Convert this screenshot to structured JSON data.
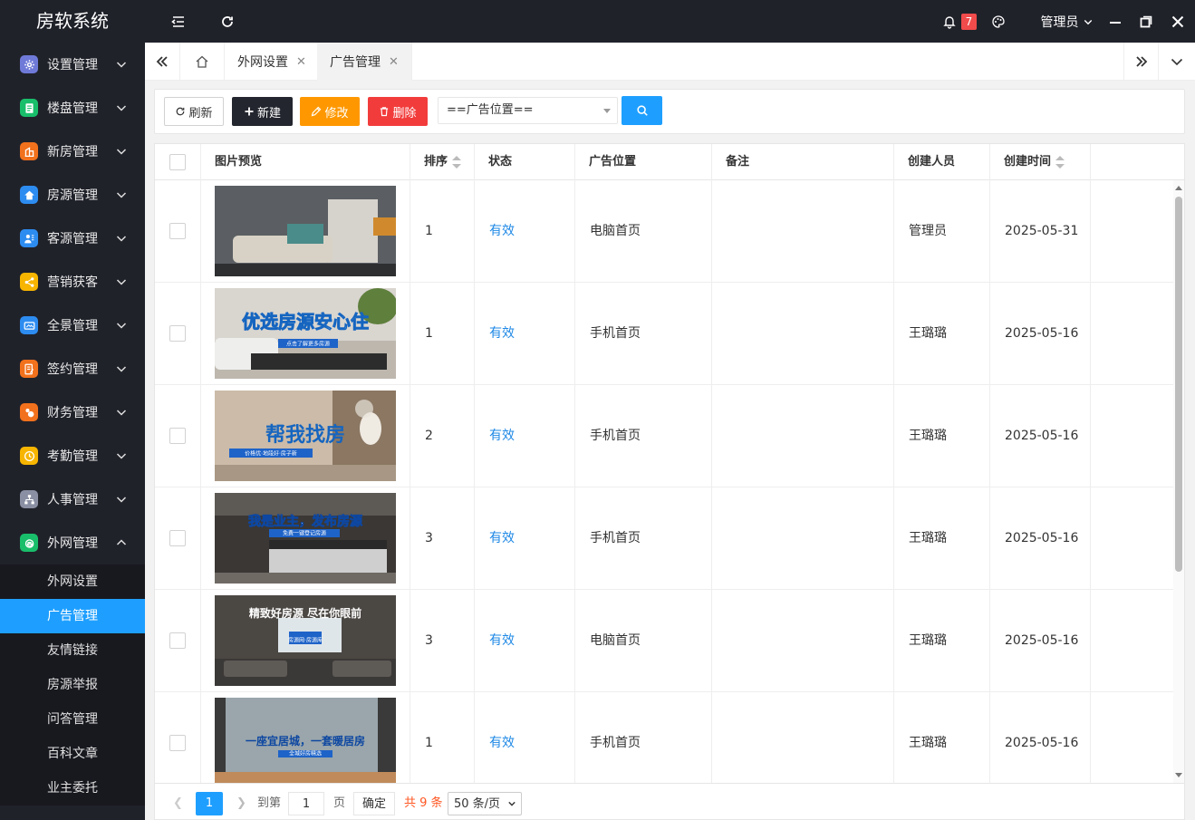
{
  "app": {
    "title": "房软系统"
  },
  "header": {
    "notify_count": "7",
    "user": "管理员"
  },
  "sidebar": {
    "items": [
      {
        "label": "设置管理",
        "icon": "gear-icon",
        "color": "#6f7ad8"
      },
      {
        "label": "楼盘管理",
        "icon": "document-icon",
        "color": "#19be6b"
      },
      {
        "label": "新房管理",
        "icon": "building-icon",
        "color": "#f2711c"
      },
      {
        "label": "房源管理",
        "icon": "home-icon",
        "color": "#2d8cf0"
      },
      {
        "label": "客源管理",
        "icon": "users-icon",
        "color": "#2d8cf0"
      },
      {
        "label": "营销获客",
        "icon": "share-icon",
        "color": "#f7b500"
      },
      {
        "label": "全景管理",
        "icon": "panorama-icon",
        "color": "#2d8cf0"
      },
      {
        "label": "签约管理",
        "icon": "contract-icon",
        "color": "#f2711c"
      },
      {
        "label": "财务管理",
        "icon": "money-bag-icon",
        "color": "#f2711c"
      },
      {
        "label": "考勤管理",
        "icon": "clock-icon",
        "color": "#f7b500"
      },
      {
        "label": "人事管理",
        "icon": "org-chart-icon",
        "color": "#8a8fa3"
      },
      {
        "label": "外网管理",
        "icon": "ie-icon",
        "color": "#19be6b"
      }
    ],
    "sub_items": [
      "外网设置",
      "广告管理",
      "友情链接",
      "房源举报",
      "问答管理",
      "百科文章",
      "业主委托"
    ]
  },
  "tabs": [
    {
      "label": "外网设置"
    },
    {
      "label": "广告管理"
    }
  ],
  "toolbar": {
    "refresh": "刷新",
    "new": "新建",
    "edit": "修改",
    "delete": "删除",
    "position_select": "==广告位置==",
    "colors": {
      "new": "#23262e",
      "edit": "#ff9800",
      "delete": "#f23c3c",
      "search": "#1e9fff"
    }
  },
  "table": {
    "columns": [
      "图片预览",
      "排序",
      "状态",
      "广告位置",
      "备注",
      "创建人员",
      "创建时间"
    ],
    "rows": [
      {
        "sort": "1",
        "status": "有效",
        "position": "电脑首页",
        "remark": "",
        "creator": "管理员",
        "created": "2025-05-31",
        "banner_text": "",
        "banner_sub": ""
      },
      {
        "sort": "1",
        "status": "有效",
        "position": "手机首页",
        "remark": "",
        "creator": "王璐璐",
        "created": "2025-05-16",
        "banner_text": "优选房源安心住",
        "banner_sub": "点击了解更多房源"
      },
      {
        "sort": "2",
        "status": "有效",
        "position": "手机首页",
        "remark": "",
        "creator": "王璐璐",
        "created": "2025-05-16",
        "banner_text": "帮我找房",
        "banner_sub": "价格优·地段好·房子新"
      },
      {
        "sort": "3",
        "status": "有效",
        "position": "手机首页",
        "remark": "",
        "creator": "王璐璐",
        "created": "2025-05-16",
        "banner_text": "我是业主，发布房源",
        "banner_sub": "免费一键登记房源"
      },
      {
        "sort": "3",
        "status": "有效",
        "position": "电脑首页",
        "remark": "",
        "creator": "王璐璐",
        "created": "2025-05-16",
        "banner_text": "精致好房源 尽在你眼前",
        "banner_sub": "房源网·房源库"
      },
      {
        "sort": "1",
        "status": "有效",
        "position": "手机首页",
        "remark": "",
        "creator": "王璐璐",
        "created": "2025-05-16",
        "banner_text": "一座宜居城，一套暖居房",
        "banner_sub": "全城好房精选"
      }
    ]
  },
  "pager": {
    "current": "1",
    "goto_label": "到第",
    "goto_value": "1",
    "page_label": "页",
    "confirm": "确定",
    "total": "共 9 条",
    "page_size": "50 条/页"
  }
}
